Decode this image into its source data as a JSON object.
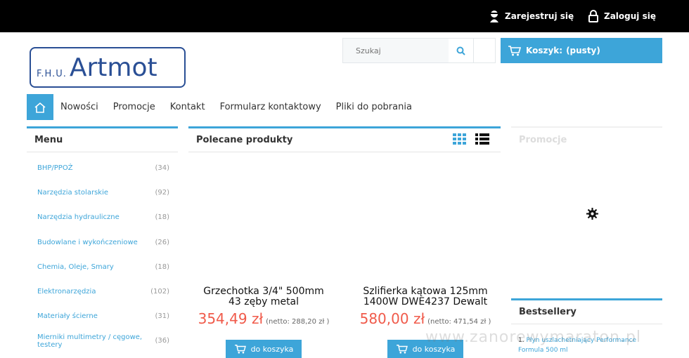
{
  "topbar": {
    "register": "Zarejestruj się",
    "login": "Zaloguj się"
  },
  "logo": {
    "small": "F.H.U.",
    "big": "Artmot"
  },
  "search": {
    "placeholder": "Szukaj"
  },
  "cart": {
    "label": "Koszyk:",
    "status": "(pusty)"
  },
  "nav": {
    "items": [
      "Nowości",
      "Promocje",
      "Kontakt",
      "Formularz kontaktowy",
      "Pliki do pobrania"
    ]
  },
  "menu": {
    "title": "Menu",
    "items": [
      {
        "label": "BHP/PPOŻ",
        "count": "(34)"
      },
      {
        "label": "Narzędzia stolarskie",
        "count": "(92)"
      },
      {
        "label": "Narzędzia hydrauliczne",
        "count": "(18)"
      },
      {
        "label": "Budowlane i wykończeniowe",
        "count": "(26)"
      },
      {
        "label": "Chemia, Oleje, Smary",
        "count": "(18)"
      },
      {
        "label": "Elektronarzędzia",
        "count": "(102)"
      },
      {
        "label": "Materiały ścierne",
        "count": "(31)"
      },
      {
        "label": "Mierniki multimetry / cęgowe, testery",
        "count": "(36)"
      }
    ]
  },
  "featured": {
    "title": "Polecane produkty",
    "products": [
      {
        "name_line1": "Grzechotka 3/4\" 500mm",
        "name_line2": "43 zęby metal",
        "price": "354,49 zł",
        "net": "(netto: 288,20 zł )",
        "button": "do koszyka"
      },
      {
        "name_line1": "Szlifierka kątowa 125mm",
        "name_line2": "1400W DWE4237 Dewalt",
        "price": "580,00 zł",
        "net": "(netto: 471,54 zł )",
        "button": "do koszyka"
      }
    ]
  },
  "promo": {
    "title": "Promocje"
  },
  "bestsellers": {
    "title": "Bestsellery",
    "item_num": "1.",
    "item_line1": "Płyn uszlachetniający Performance",
    "item_line2": "Formula 500 ml"
  },
  "watermark": "www.zanorewymaraton.pl",
  "colors": {
    "accent": "#3da5d9",
    "price": "#f05a4a",
    "topbar": "#000000"
  }
}
